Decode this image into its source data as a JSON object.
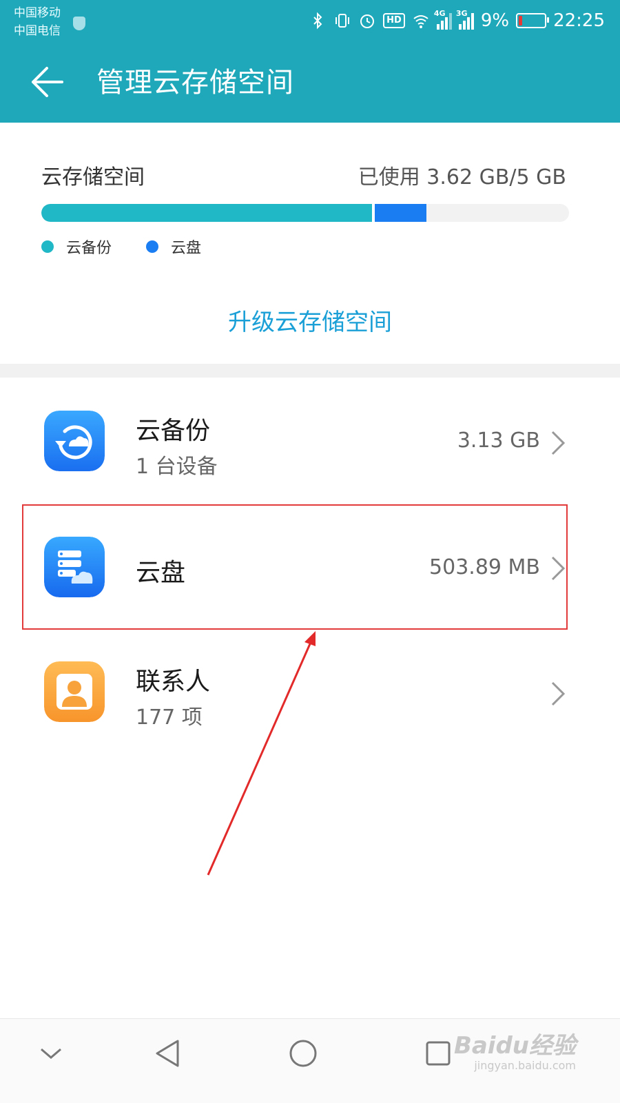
{
  "status_bar": {
    "carrier_1": "中国移动",
    "carrier_2": "中国电信",
    "signal_1_label": "4G",
    "signal_2_label": "3G",
    "battery_text": "9%",
    "time": "22:25",
    "hd_label": "HD"
  },
  "header": {
    "title": "管理云存储空间"
  },
  "storage": {
    "label": "云存储空间",
    "used_text": "已使用 3.62 GB/5 GB",
    "used_fraction": 0.724,
    "backup_fraction": 0.626,
    "disk_fraction": 0.098,
    "legend": [
      {
        "label": "云备份",
        "color": "#20b7c6"
      },
      {
        "label": "云盘",
        "color": "#1a7ef2"
      }
    ],
    "upgrade_label": "升级云存储空间"
  },
  "items": [
    {
      "name": "云备份",
      "sub": "1 台设备",
      "size": "3.13 GB",
      "icon": "cloud-backup-icon"
    },
    {
      "name": "云盘",
      "sub": "",
      "size": "503.89 MB",
      "icon": "cloud-disk-icon"
    },
    {
      "name": "联系人",
      "sub": "177 项",
      "size": "",
      "icon": "contacts-icon"
    }
  ],
  "watermark": {
    "brand": "Baidu经验",
    "url": "jingyan.baidu.com"
  }
}
